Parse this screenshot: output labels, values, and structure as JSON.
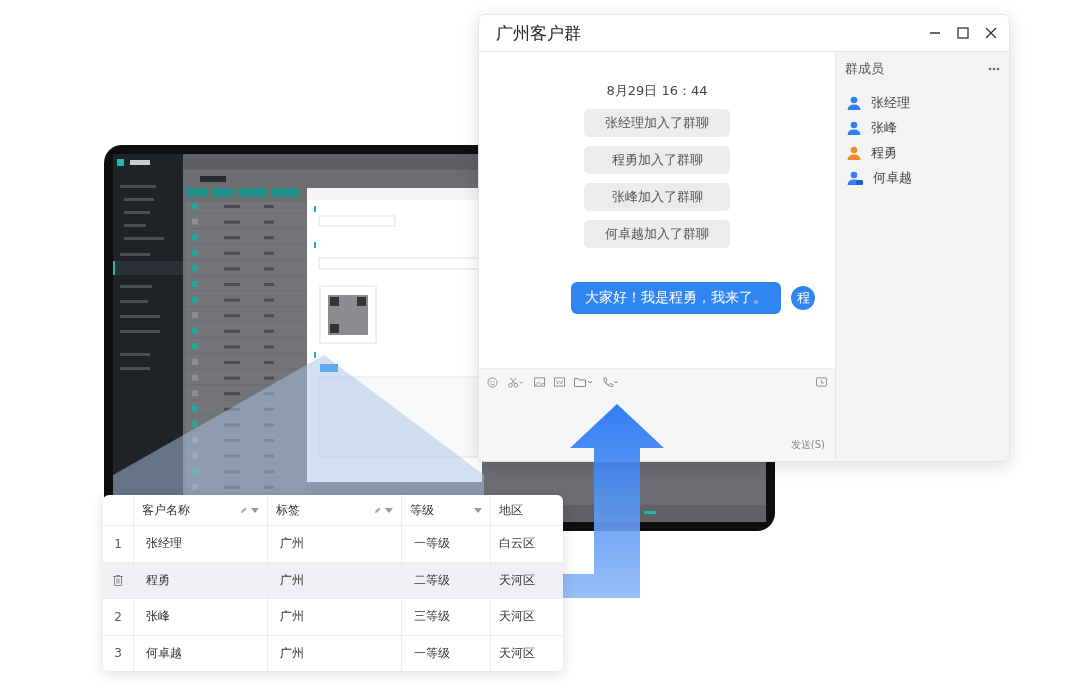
{
  "chat_window": {
    "title": "广州客户群",
    "timestamp": "8月29日  16：44",
    "system_messages": [
      "张经理加入了群聊",
      "程勇加入了群聊",
      "张峰加入了群聊",
      "何卓越加入了群聊"
    ],
    "messages": [
      {
        "text": "大家好！我是程勇，我来了。",
        "avatar": "程"
      }
    ],
    "send_button": "发送(S)",
    "members_panel": {
      "title": "群成员",
      "members": [
        {
          "name": "张经理",
          "color": "#2f7ff0",
          "kind": "member"
        },
        {
          "name": "张峰",
          "color": "#2f7ff0",
          "kind": "member"
        },
        {
          "name": "程勇",
          "color": "#f08a24",
          "kind": "member"
        },
        {
          "name": "何卓越",
          "color": "#2f7ff0",
          "kind": "manager"
        }
      ]
    }
  },
  "customer_table": {
    "columns": [
      {
        "label": "客户名称",
        "edit": true,
        "filter": true
      },
      {
        "label": "标签",
        "edit": true,
        "filter": true
      },
      {
        "label": "等级",
        "edit": false,
        "filter": true
      },
      {
        "label": "地区",
        "edit": false,
        "filter": false
      }
    ],
    "rows": [
      {
        "kind": "number",
        "index": "1",
        "hovered": false,
        "cells": [
          "张经理",
          "广州",
          "一等级",
          "白云区"
        ]
      },
      {
        "kind": "delete",
        "hovered": true,
        "cells": [
          "程勇",
          "广州",
          "二等级",
          "天河区"
        ]
      },
      {
        "kind": "number",
        "index": "2",
        "hovered": false,
        "cells": [
          "张峰",
          "广州",
          "三等级",
          "天河区"
        ]
      },
      {
        "kind": "number",
        "index": "3",
        "hovered": false,
        "cells": [
          "何卓越",
          "广州",
          "一等级",
          "天河区"
        ]
      }
    ]
  }
}
